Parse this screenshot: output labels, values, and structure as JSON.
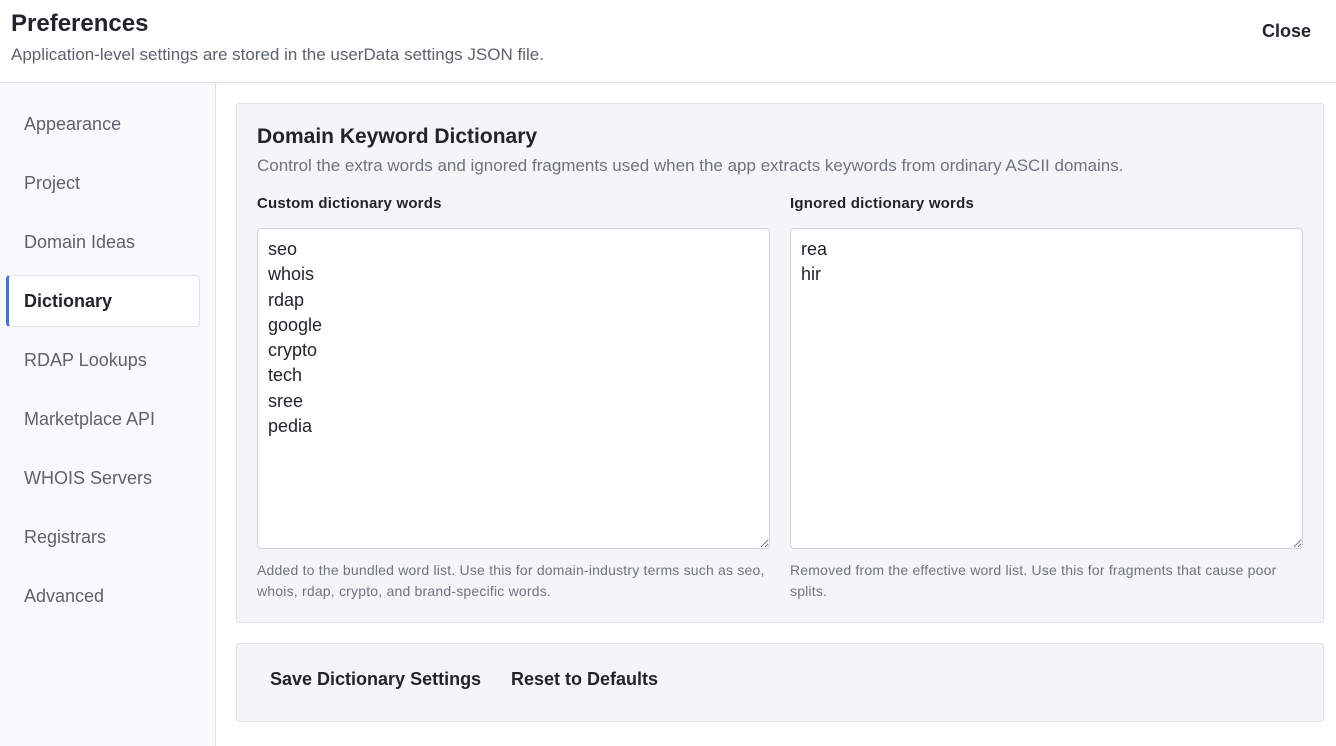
{
  "header": {
    "title": "Preferences",
    "subtitle": "Application-level settings are stored in the userData settings JSON file.",
    "close_label": "Close"
  },
  "sidebar": {
    "items": [
      {
        "label": "Appearance",
        "active": false
      },
      {
        "label": "Project",
        "active": false
      },
      {
        "label": "Domain Ideas",
        "active": false
      },
      {
        "label": "Dictionary",
        "active": true
      },
      {
        "label": "RDAP Lookups",
        "active": false
      },
      {
        "label": "Marketplace API",
        "active": false
      },
      {
        "label": "WHOIS Servers",
        "active": false
      },
      {
        "label": "Registrars",
        "active": false
      },
      {
        "label": "Advanced",
        "active": false
      }
    ]
  },
  "dictionary": {
    "title": "Domain Keyword Dictionary",
    "description": "Control the extra words and ignored fragments used when the app extracts keywords from ordinary ASCII domains.",
    "custom": {
      "label": "Custom dictionary words",
      "value": "seo\nwhois\nrdap\ngoogle\ncrypto\ntech\nsree\npedia",
      "help": "Added to the bundled word list. Use this for domain-industry terms such as seo, whois, rdap, crypto, and brand-specific words."
    },
    "ignored": {
      "label": "Ignored dictionary words",
      "value": "rea\nhir",
      "help": "Removed from the effective word list. Use this for fragments that cause poor splits."
    }
  },
  "actions": {
    "save_label": "Save Dictionary Settings",
    "reset_label": "Reset to Defaults"
  },
  "colors": {
    "accent": "#4a6fd6",
    "panel_bg": "#f4f5f7",
    "sidebar_bg": "#f8f9fa"
  }
}
